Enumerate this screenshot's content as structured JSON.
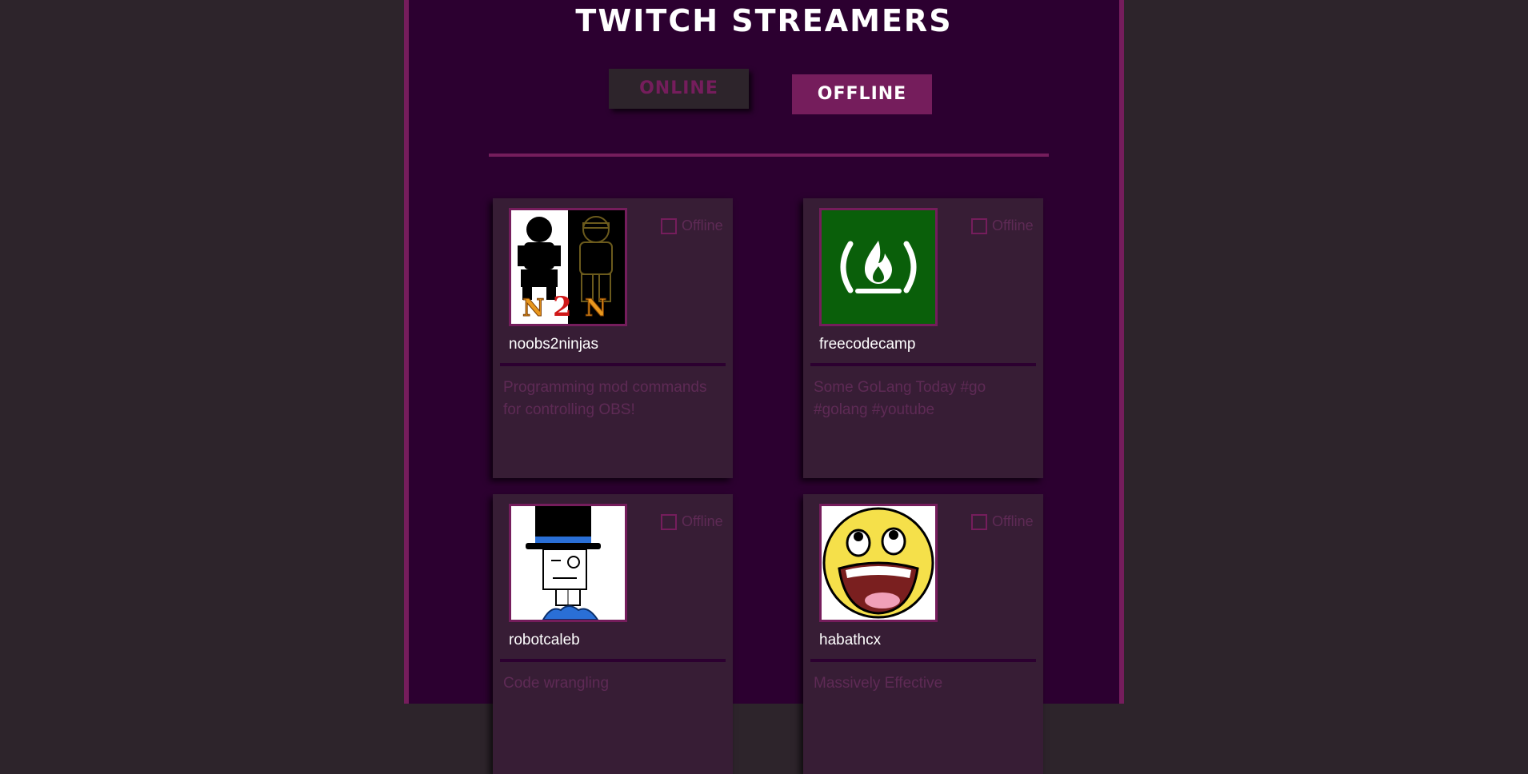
{
  "page": {
    "title": "TWITCH STREAMERS"
  },
  "filters": {
    "online_label": "ONLINE",
    "offline_label": "OFFLINE"
  },
  "streamers": [
    {
      "name": "noobs2ninjas",
      "status": "Offline",
      "description": "Programming mod commands for controlling OBS!",
      "avatar_icon": "n2n-logo-icon"
    },
    {
      "name": "freecodecamp",
      "status": "Offline",
      "description": "Some GoLang Today #go #golang #youtube",
      "avatar_icon": "freecodecamp-logo-icon"
    },
    {
      "name": "robotcaleb",
      "status": "Offline",
      "description": "Code wrangling",
      "avatar_icon": "robot-top-hat-icon"
    },
    {
      "name": "habathcx",
      "status": "Offline",
      "description": "Massively Effective",
      "avatar_icon": "awesome-face-icon"
    }
  ],
  "colors": {
    "page_bg": "#2d242b",
    "container_bg": "#2c0030",
    "accent": "#751d5c",
    "card_bg": "#371d35",
    "muted_text": "#5e2a55"
  }
}
